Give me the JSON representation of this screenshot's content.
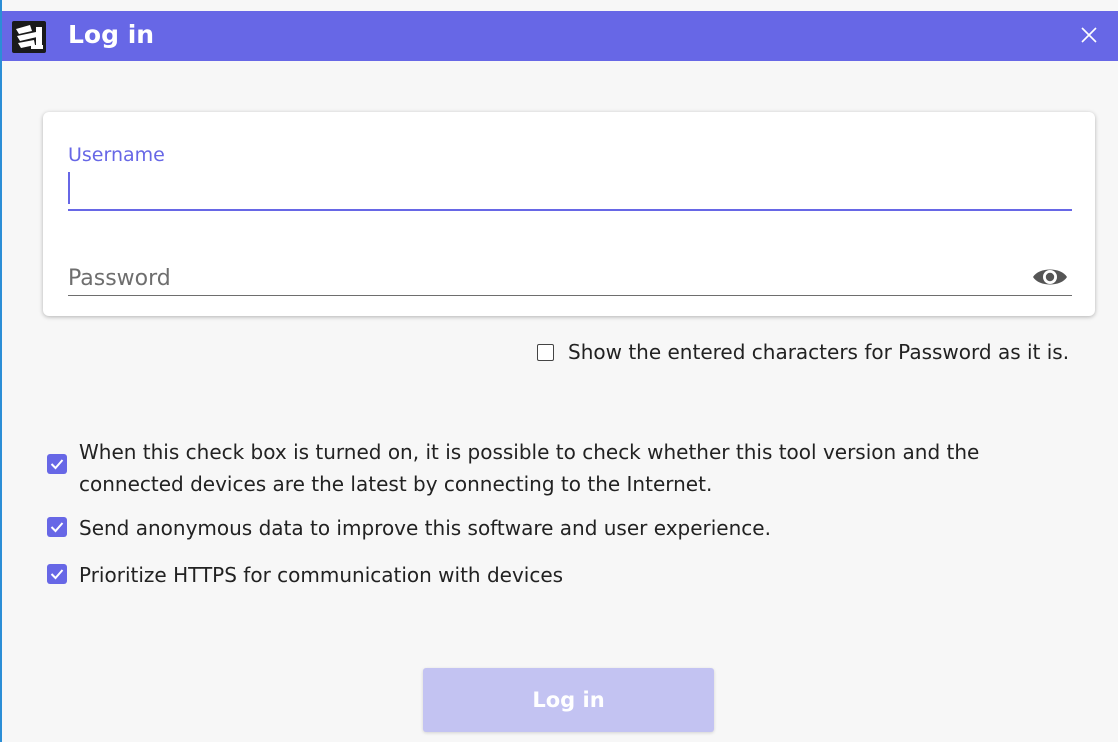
{
  "window": {
    "title": "Log in",
    "accent_color": "#6767e6"
  },
  "form": {
    "username": {
      "label": "Username",
      "value": ""
    },
    "password": {
      "placeholder": "Password",
      "value": ""
    }
  },
  "show_password": {
    "label": "Show the entered characters for Password as it is.",
    "checked": false
  },
  "options": [
    {
      "label": "When this check box is turned on, it is possible to check whether this tool version and the connected devices are the latest by connecting to the Internet.",
      "checked": true
    },
    {
      "label": "Send anonymous data to improve this software and user experience.",
      "checked": true
    },
    {
      "label": "Prioritize HTTPS for communication with devices",
      "checked": true
    }
  ],
  "login_button": {
    "label": "Log in",
    "enabled": false
  },
  "icons": {
    "app": "app-logo-icon",
    "close": "close-icon",
    "reveal": "eye-icon",
    "check": "checkmark-icon"
  }
}
